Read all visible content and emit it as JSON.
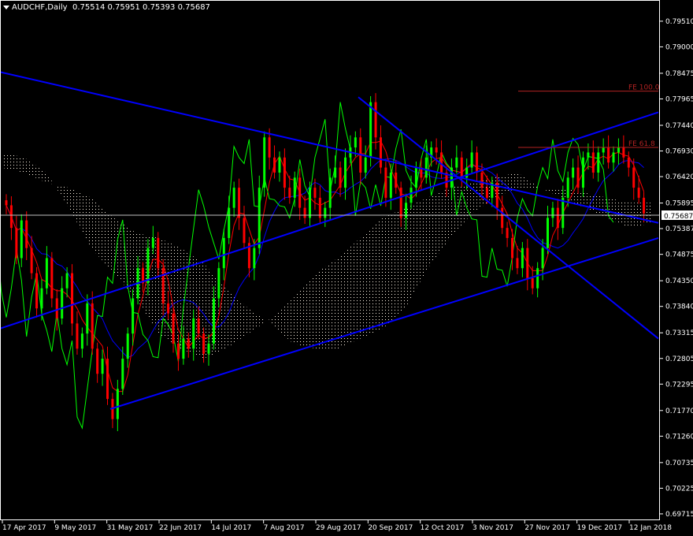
{
  "header": {
    "symbol": "AUDCHF,Daily",
    "ohlc": "0.75514 0.75951 0.75393 0.75687"
  },
  "chart_data": {
    "type": "candlestick",
    "symbol": "AUDCHF",
    "timeframe": "Daily",
    "ylim": [
      0.6962,
      0.799
    ],
    "y_ticks": [
      "0.79510",
      "0.79000",
      "0.78475",
      "0.77965",
      "0.77440",
      "0.76930",
      "0.76420",
      "0.75895",
      "0.75387",
      "0.74875",
      "0.74350",
      "0.73840",
      "0.73315",
      "0.72805",
      "0.72295",
      "0.71770",
      "0.71260",
      "0.70735",
      "0.70225",
      "0.69715"
    ],
    "x_ticks": [
      "17 Apr 2017",
      "9 May 2017",
      "31 May 2017",
      "22 Jun 2017",
      "14 Jul 2017",
      "7 Aug 2017",
      "29 Aug 2017",
      "20 Sep 2017",
      "12 Oct 2017",
      "3 Nov 2017",
      "27 Nov 2017",
      "19 Dec 2017",
      "12 Jan 2018"
    ],
    "current_price": "0.75687",
    "fibo_labels": [
      {
        "label": "FE 100.0",
        "price": 0.7812
      },
      {
        "label": "FE 61.8",
        "price": 0.77
      }
    ],
    "close_series": [
      0.7585,
      0.754,
      0.748,
      0.7555,
      0.75,
      0.745,
      0.738,
      0.742,
      0.748,
      0.74,
      0.736,
      0.742,
      0.745,
      0.735,
      0.73,
      0.733,
      0.739,
      0.73,
      0.725,
      0.728,
      0.72,
      0.716,
      0.722,
      0.728,
      0.733,
      0.74,
      0.746,
      0.743,
      0.75,
      0.752,
      0.746,
      0.739,
      0.737,
      0.731,
      0.728,
      0.732,
      0.73,
      0.736,
      0.733,
      0.729,
      0.731,
      0.74,
      0.746,
      0.752,
      0.758,
      0.762,
      0.756,
      0.751,
      0.746,
      0.75,
      0.762,
      0.772,
      0.768,
      0.765,
      0.768,
      0.762,
      0.76,
      0.764,
      0.758,
      0.756,
      0.762,
      0.76,
      0.756,
      0.758,
      0.764,
      0.766,
      0.762,
      0.768,
      0.77,
      0.772,
      0.765,
      0.768,
      0.779,
      0.772,
      0.766,
      0.76,
      0.765,
      0.762,
      0.756,
      0.759,
      0.762,
      0.766,
      0.764,
      0.768,
      0.77,
      0.769,
      0.765,
      0.762,
      0.766,
      0.768,
      0.764,
      0.766,
      0.769,
      0.765,
      0.762,
      0.76,
      0.763,
      0.758,
      0.754,
      0.752,
      0.748,
      0.746,
      0.75,
      0.744,
      0.742,
      0.746,
      0.75,
      0.756,
      0.758,
      0.754,
      0.76,
      0.764,
      0.766,
      0.762,
      0.768,
      0.769,
      0.765,
      0.769,
      0.77,
      0.767,
      0.769,
      0.77,
      0.768,
      0.766,
      0.762,
      0.76,
      0.7569
    ],
    "ichimoku_cloud": {
      "span_a": [
        0.766,
        0.765,
        0.763,
        0.762,
        0.76,
        0.756,
        0.753,
        0.752,
        0.75,
        0.747,
        0.742,
        0.738,
        0.735,
        0.731,
        0.73,
        0.73,
        0.732,
        0.734,
        0.738,
        0.746,
        0.752,
        0.757,
        0.76,
        0.762,
        0.762,
        0.762,
        0.761,
        0.76,
        0.759,
        0.759
      ],
      "span_b": [
        0.769,
        0.768,
        0.765,
        0.758,
        0.75,
        0.745,
        0.74,
        0.733,
        0.73,
        0.728,
        0.73,
        0.733,
        0.736,
        0.74,
        0.745,
        0.748,
        0.752,
        0.756,
        0.758,
        0.76,
        0.762,
        0.763,
        0.764,
        0.765,
        0.762,
        0.76,
        0.758,
        0.756,
        0.754,
        0.755
      ]
    },
    "trend_lines": [
      {
        "name": "Descending channel upper",
        "color": "#0000ff"
      },
      {
        "name": "Ascending channel lower",
        "color": "#0000ff"
      },
      {
        "name": "Descending channel lower",
        "color": "#0000ff"
      },
      {
        "name": "Ascending channel upper",
        "color": "#0000ff"
      }
    ],
    "colors": {
      "background": "#000000",
      "bull_candle": "#00ff00",
      "bear_candle": "#ff0000",
      "chikou": "#00ff00",
      "kijun": "#0000ff",
      "tenkan": "#ff0000",
      "cloud_dots": "#fff5e6",
      "grid": "#ffffff",
      "trend": "#0000ff",
      "fibo": "#b22222",
      "price_line": "#c0c0c0"
    }
  }
}
